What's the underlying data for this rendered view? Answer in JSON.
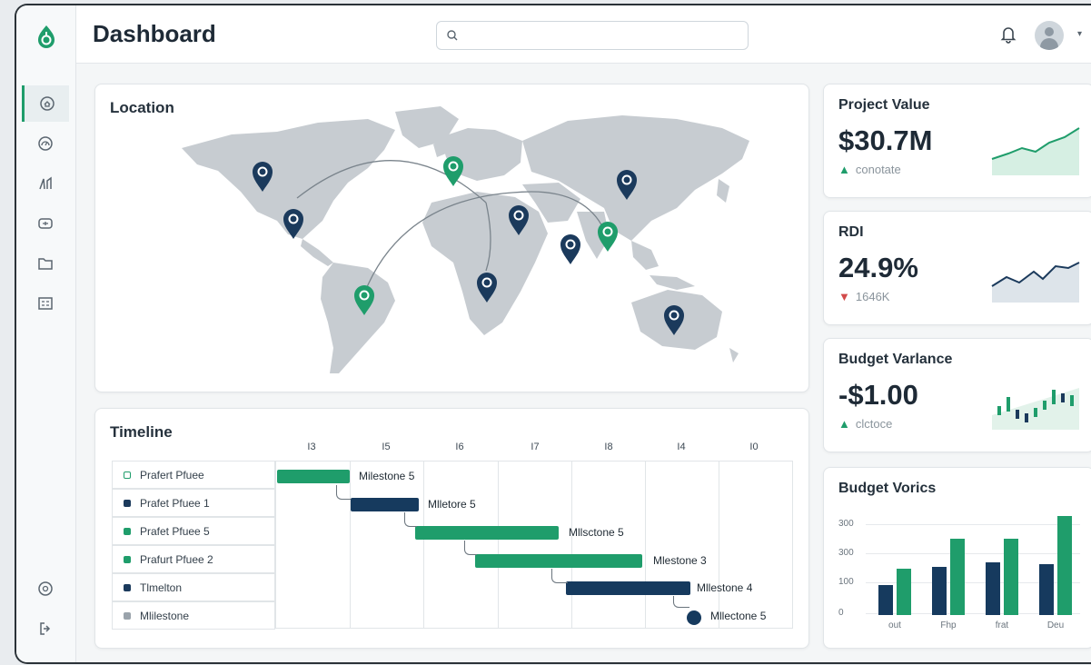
{
  "header": {
    "title": "Dashboard",
    "search_placeholder": ""
  },
  "sidebar": {
    "items": [
      {
        "icon": "home-icon",
        "active": true
      },
      {
        "icon": "gauge-icon",
        "active": false
      },
      {
        "icon": "chart-icon",
        "active": false
      },
      {
        "icon": "monitor-icon",
        "active": false
      },
      {
        "icon": "folder-icon",
        "active": false
      },
      {
        "icon": "grid-icon",
        "active": false
      }
    ],
    "bottom_items": [
      {
        "icon": "settings-icon"
      },
      {
        "icon": "logout-icon"
      }
    ]
  },
  "location": {
    "title": "Location",
    "pins": [
      {
        "color": "#1b3a5c"
      },
      {
        "color": "#1b3a5c"
      },
      {
        "color": "#1f9d6b"
      },
      {
        "color": "#1b3a5c"
      },
      {
        "color": "#1b3a5c"
      },
      {
        "color": "#1b3a5c"
      },
      {
        "color": "#1f9d6b"
      },
      {
        "color": "#1f9d6b"
      },
      {
        "color": "#1b3a5c"
      },
      {
        "color": "#1b3a5c"
      }
    ]
  },
  "kpis": {
    "project_value": {
      "title": "Project Value",
      "value": "$30.7M",
      "sub": "conotate",
      "trend": "up"
    },
    "roi": {
      "title": "RDI",
      "value": "24.9%",
      "sub": "1646K",
      "trend": "down"
    },
    "budget_variance": {
      "title": "Budget Varlance",
      "value": "-$1.00",
      "sub": "clctoce",
      "trend": "up"
    }
  },
  "timeline": {
    "title": "Timeline",
    "columns": [
      "I3",
      "I5",
      "I6",
      "I7",
      "I8",
      "I4",
      "I0"
    ],
    "rows": [
      {
        "label": "Prafert Pfuee",
        "color": "#1f9d6b",
        "outline": true
      },
      {
        "label": "Prafet Pfuee 1",
        "color": "#1b3a5c",
        "outline": false
      },
      {
        "label": "Prafet Pfuee 5",
        "color": "#1f9d6b",
        "outline": false
      },
      {
        "label": "Prafurt Pfuee 2",
        "color": "#1f9d6b",
        "outline": false
      },
      {
        "label": "Tlmelton",
        "color": "#1b3a5c",
        "outline": false
      },
      {
        "label": "Mlilestone",
        "color": "#9aa3ab",
        "outline": false
      }
    ],
    "milestones": [
      "Milestone 5",
      "Mlletore 5",
      "Mllsctone 5",
      "Mlestone 3",
      "Mllestone 4",
      "Mllectone 5"
    ],
    "colors": {
      "green": "#1f9d6b",
      "navy": "#163a5e"
    }
  },
  "budget_chart": {
    "title": "Budget Vorics",
    "y_ticks": [
      "300",
      "300",
      "100",
      "0"
    ],
    "x_ticks": [
      "out",
      "Fhp",
      "frat",
      "Deu"
    ]
  },
  "chart_data": {
    "type": "bar",
    "title": "Budget Vorics",
    "categories": [
      "out",
      "Fhp",
      "frat",
      "Deu"
    ],
    "series": [
      {
        "values": [
          100,
          160,
          175,
          170
        ],
        "color": "#163a5e"
      },
      {
        "values": [
          155,
          255,
          255,
          330
        ],
        "color": "#1f9d6b"
      }
    ],
    "ylim": [
      0,
      400
    ],
    "y_ticks": [
      "300",
      "300",
      "100",
      "0"
    ]
  }
}
